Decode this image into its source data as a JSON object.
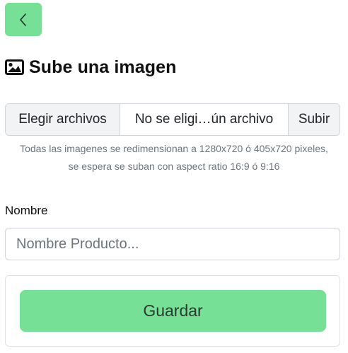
{
  "header": {
    "back_icon": "chevron-left-icon"
  },
  "title": {
    "icon": "image-icon",
    "text": "Sube una imagen"
  },
  "file_upload": {
    "choose_label": "Elegir archivos",
    "status_text": "No se eligi…ún archivo",
    "upload_label": "Subir"
  },
  "help_text": {
    "line1": "Todas las imagenes se redimensionan a 1280x720 ó 405x720 pixeles,",
    "line2": "se espera se suban con aspect ratio 16:9 ó 9:16"
  },
  "form": {
    "name_label": "Nombre",
    "name_placeholder": "Nombre Producto...",
    "name_value": ""
  },
  "actions": {
    "save_label": "Guardar"
  },
  "colors": {
    "accent": "#75e096",
    "muted_text": "#6c757d",
    "border": "#ced4da"
  }
}
